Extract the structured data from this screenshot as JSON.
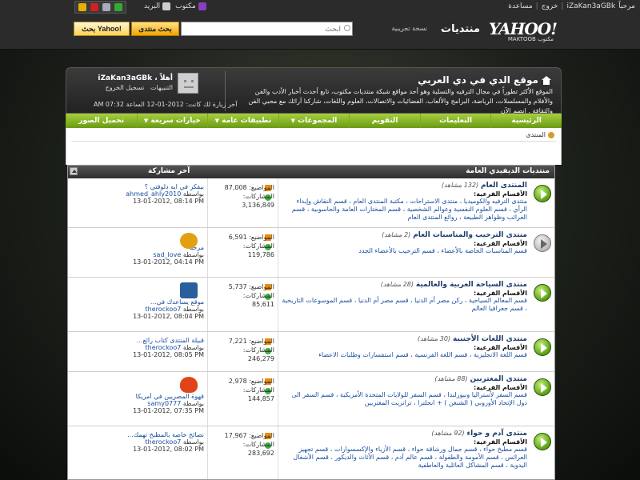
{
  "topbar": {
    "mail_label": "البريد",
    "messenger_label": "مكتوب",
    "greeting": "مرحباً",
    "username": "iZaKan3aGBk",
    "logout": "خروج",
    "help": "مساعدة"
  },
  "brand": {
    "logo": "YAHOO!",
    "logo_sub": "MAKTOOB مكتوب",
    "forum_title": "منتديات",
    "beta": "نسخة تجريبية"
  },
  "search": {
    "placeholder": "ابحث",
    "forum_button": "بحث منتدى",
    "yahoo_button": "بحث Yahoo!"
  },
  "site": {
    "name": "موقع الدي في دي العربي",
    "description": "الموقع الأكثر تطوراً في مجال الترفيه والتسلية وهو أحد مواقع شبكة منتديات مكتوب، تابع أحدث أخبار الأدب والفن والأفلام والمسلسلات، الرياضة، البرامج والألعاب، الفضائيات والاتصالات، العلوم واللغات، شاركنا آرائك مع محبي الفن والثقافة . انضم الآن"
  },
  "user": {
    "welcome": "أهلاً ، iZaKan3aGBk",
    "notifications": "التنبيهات",
    "logout": "تسجيل الخروج",
    "last_visit": "آخر زيارة لك كانت: 2012-01-12 الساعة 07:32 AM"
  },
  "nav": [
    {
      "label": "الرئيسية",
      "dropdown": false
    },
    {
      "label": "التعليمات",
      "dropdown": false
    },
    {
      "label": "التقويم",
      "dropdown": false
    },
    {
      "label": "المجموعات",
      "dropdown": true
    },
    {
      "label": "تطبيقات عامة",
      "dropdown": true
    },
    {
      "label": "خيارات سريعة",
      "dropdown": true
    },
    {
      "label": "تحميل الصور",
      "dropdown": false
    }
  ],
  "breadcrumb": "المنتدى",
  "table": {
    "section_title": "منتديات الديفيدي العامة",
    "last_post_header": "آخر مشاركة"
  },
  "forums": [
    {
      "title": "المنتدى العام",
      "views": "(132 مشاهد)",
      "icon": "play-green",
      "subforums_label": "الأقسام الفرعية:",
      "subforums": "منتدى الترفيه والكوميديا ، منتدى الاستراحات ، مكتبة المنتدى العام ، قسم النقاش وإبداء الرأي ، قسم العلوم النفسية وعوالم الشخصية ، قسم المختارات العامة والحاسوبية ، قسم الغرائب وظواهر الطبيعة ، روائع المنتدى العام",
      "topics": "المواضيع: 87,008",
      "posts_label": "المشاركات:",
      "posts": "3,136,849",
      "last_title": "بيفكر في ايه دلوقتي ؟",
      "last_by_label": "بواسطة",
      "last_user": "ahmed_ahly2010",
      "last_date": "13-01-2012, 08:14 PM",
      "thumb_color": ""
    },
    {
      "title": "منتدى الترحيب والمناسبات العام",
      "views": "(2 مشاهد)",
      "icon": "play-gray",
      "subforums_label": "الأقسام الفرعية:",
      "subforums": "قسم المناسبات الخاصة بالأعضاء ، قسم الترحيب بالأعضاء الجدد",
      "topics": "المواضيع: 6,591",
      "posts_label": "المشاركات:",
      "posts": "119,786",
      "last_title": "مرحبا",
      "last_by_label": "بواسطة",
      "last_user": "sad_love",
      "last_date": "13-01-2012, 04:14 PM",
      "thumb_color": "#e0a010"
    },
    {
      "title": "منتدى السياحة العربية والعالمية",
      "views": "(28 مشاهد)",
      "icon": "play-green",
      "subforums_label": "الأقسام الفرعية:",
      "subforums": "قسم المعالم السياحية ، ركن مصر أم الدنيا ، قسم مصر أم الدنيا ، قسم الموسوعات التاريخية ، قسم جغرافيا العالم",
      "topics": "المواضيع: 5,737",
      "posts_label": "المشاركات:",
      "posts": "85,611",
      "last_title": "موقع يساعدك في...",
      "last_by_label": "بواسطة",
      "last_user": "therockoo7",
      "last_date": "13-01-2012, 08:04 PM",
      "thumb_color": "#2a5f9e"
    },
    {
      "title": "منتدى اللغات الأجنبية",
      "views": "(30 مشاهد)",
      "icon": "play-green",
      "subforums_label": "الأقسام الفرعية:",
      "subforums": "قسم اللغة الانجليزية ، قسم اللغة الفرنسية ، قسم استفسارات وطلبات الاعضاء",
      "topics": "المواضيع: 7,221",
      "posts_label": "المشاركات:",
      "posts": "246,279",
      "last_title": "قبيلة المنتدى كتاب رائع...",
      "last_by_label": "بواسطة",
      "last_user": "therockoo7",
      "last_date": "13-01-2012, 08:05 PM",
      "thumb_color": ""
    },
    {
      "title": "منتدى المغتربين",
      "views": "(88 مشاهد)",
      "icon": "play-green",
      "subforums_label": "الأقسام الفرعية:",
      "subforums": "قسم السفر لأستراليا ونيوزلندا ، قسم السفر للولايات المتحدة الأمريكية ، قسم السفر الى دول الإتحاد الأوروبي ( الشنغن ) + انجلترا ، ترانزيت المغتربين",
      "topics": "المواضيع: 2,978",
      "posts_label": "المشاركات:",
      "posts": "144,857",
      "last_title": "قهوة المصريين في أمريكا",
      "last_by_label": "بواسطة",
      "last_user": "samy0777",
      "last_date": "13-01-2012, 07:35 PM",
      "thumb_color": "#e0451a"
    },
    {
      "title": "منتدى آدم و حواء",
      "views": "(92 مشاهد)",
      "icon": "play-green",
      "subforums_label": "الأقسام الفرعية:",
      "subforums": "قسم مطبخ حواء ، قسم جمال ورشاقة حواء ، قسم الأزياء والإكسسوارات ، قسم تجهيز العرائس ، قسم الأمومة والطفولة ، قسم عالم آدم ، قسم الأثاث والديكور ، قسم الأشغال اليدوية ، قسم المشاكل العائلية والعاطفية",
      "topics": "المواضيع: 17,967",
      "posts_label": "المشاركات:",
      "posts": "283,692",
      "last_title": "نصائح خاصة بالمطبخ تهمك...",
      "last_by_label": "بواسطة",
      "last_user": "therockoo7",
      "last_date": "13-01-2012, 08:02 PM",
      "thumb_color": ""
    }
  ],
  "colors": {
    "nav_green": "#8cbf2a",
    "link_blue": "#1b4fa0",
    "forum_title": "#1b3a6b"
  }
}
